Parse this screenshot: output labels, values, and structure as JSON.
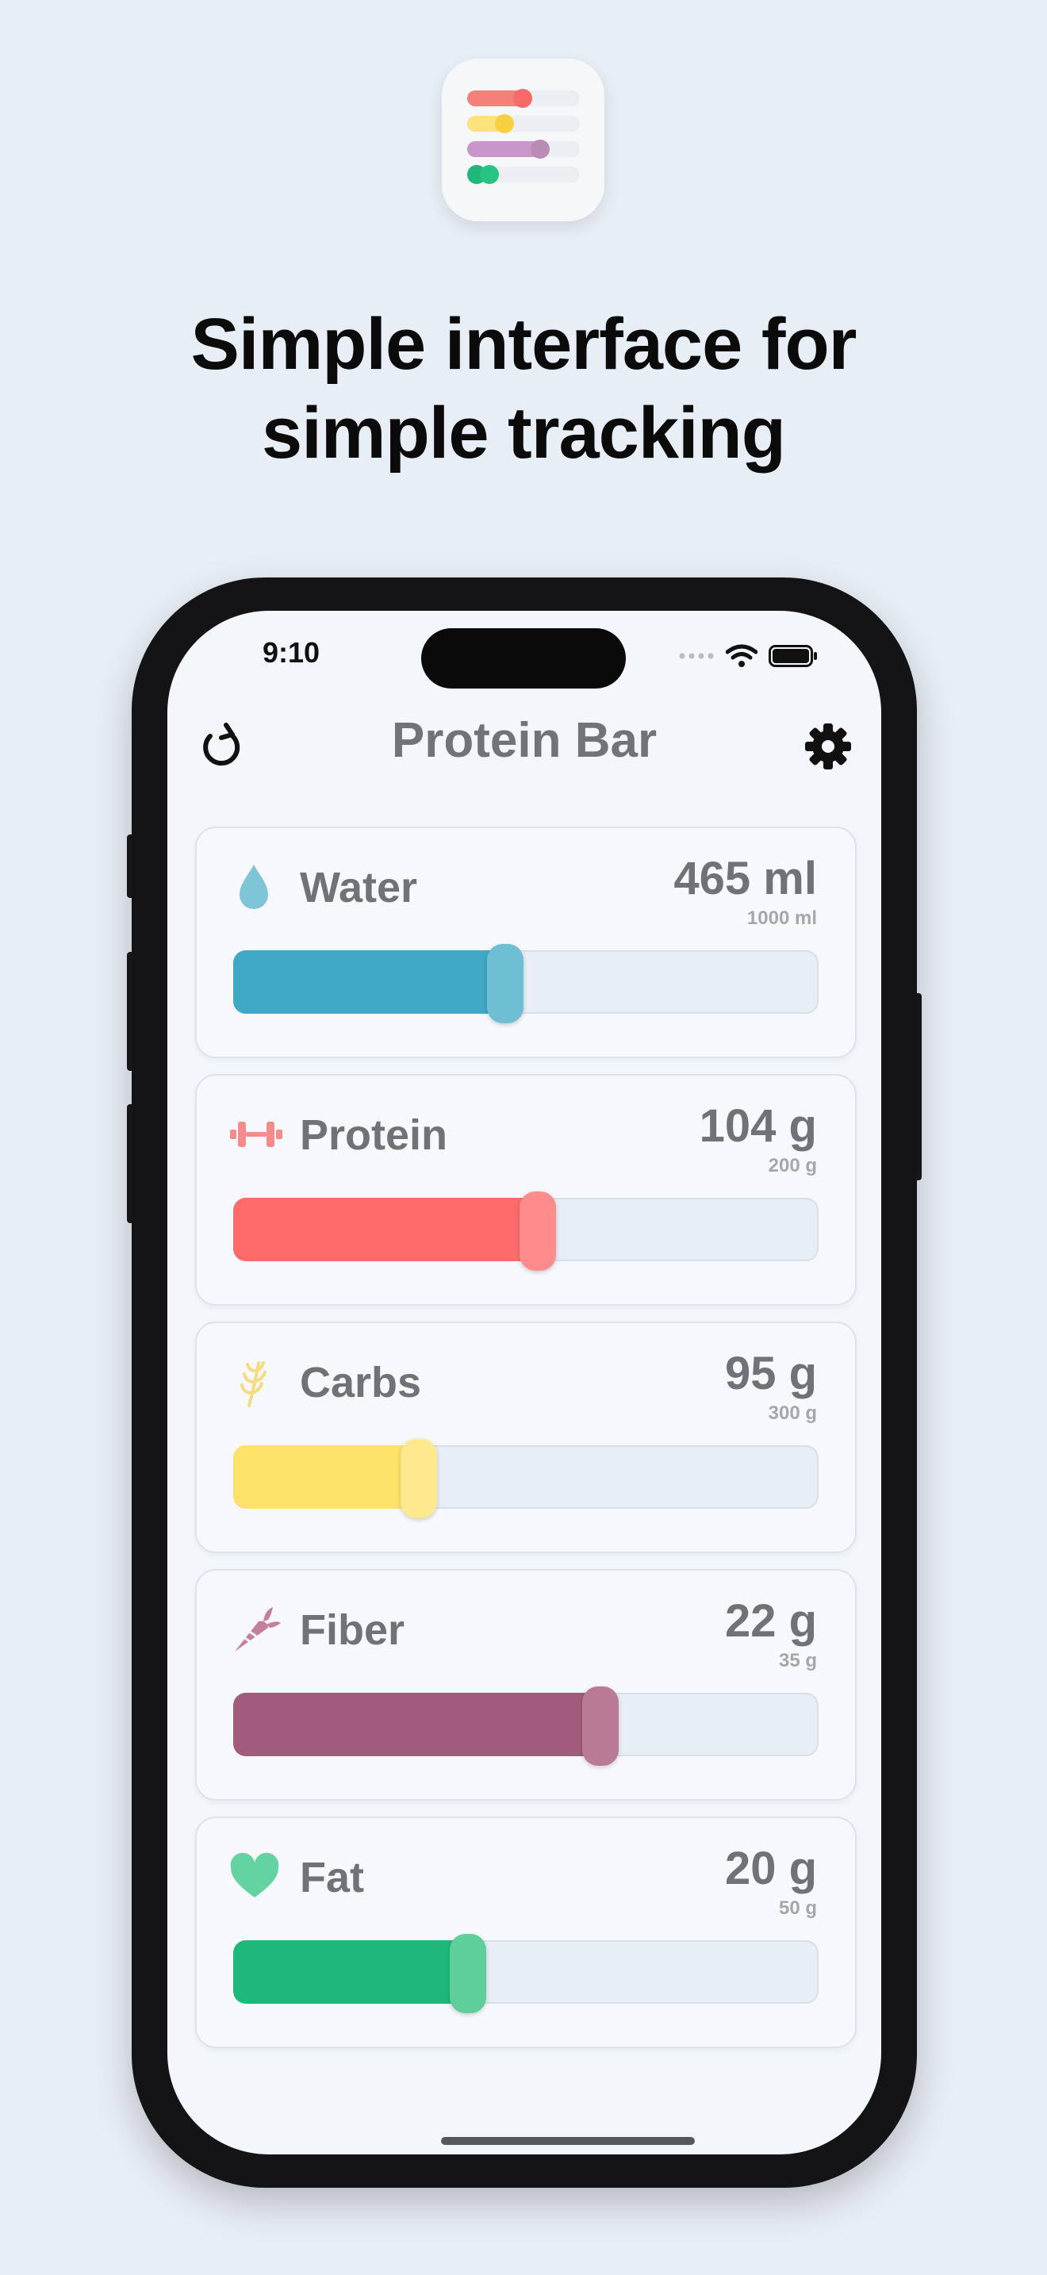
{
  "headline": {
    "line1": "Simple interface for",
    "line2": "simple tracking"
  },
  "status_bar": {
    "time": "9:10",
    "icons": [
      "cellular-dots-icon",
      "wifi-icon",
      "battery-icon"
    ]
  },
  "nav": {
    "title": "Protein Bar",
    "left_icon": "refresh-icon",
    "right_icon": "gear-icon"
  },
  "trackers": [
    {
      "name": "water",
      "label": "Water",
      "value": "465 ml",
      "goal": "1000 ml",
      "progress": 0.465,
      "icon": "water-drop-icon",
      "fill_color": "#3fa8c4",
      "handle_color": "#6ebfd3",
      "icon_color": "#7cc4d6"
    },
    {
      "name": "protein",
      "label": "Protein",
      "value": "104 g",
      "goal": "200 g",
      "progress": 0.52,
      "icon": "dumbbell-icon",
      "fill_color": "#ff6b6b",
      "handle_color": "#ff8c8c",
      "icon_color": "#f58c8c"
    },
    {
      "name": "carbs",
      "label": "Carbs",
      "value": "95 g",
      "goal": "300 g",
      "progress": 0.3167,
      "icon": "wheat-icon",
      "fill_color": "#ffe26a",
      "handle_color": "#ffe88d",
      "icon_color": "#f3dc84"
    },
    {
      "name": "fiber",
      "label": "Fiber",
      "value": "22 g",
      "goal": "35 g",
      "progress": 0.6286,
      "icon": "carrot-icon",
      "fill_color": "#a35b7b",
      "handle_color": "#b97a95",
      "icon_color": "#c47f9c"
    },
    {
      "name": "fat",
      "label": "Fat",
      "value": "20 g",
      "goal": "50 g",
      "progress": 0.4,
      "icon": "heart-icon",
      "fill_color": "#1cb97a",
      "handle_color": "#5fcf99",
      "icon_color": "#63d3a2"
    }
  ],
  "app_icon": {
    "name": "app-logo-icon"
  }
}
